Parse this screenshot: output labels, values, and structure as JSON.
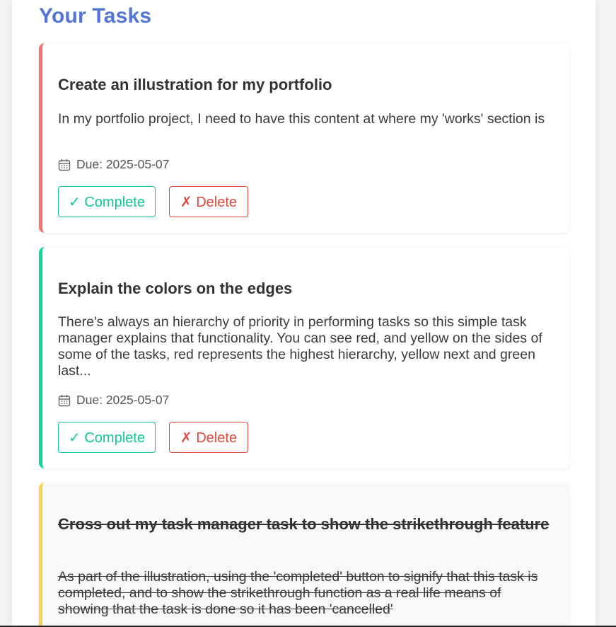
{
  "page": {
    "heading": "Your Tasks"
  },
  "colors": {
    "heading": "#5174d6",
    "priority_high": "#f87171",
    "priority_medium": "#fcd34d",
    "priority_low": "#10d6a0",
    "complete_button": "#10c799",
    "delete_button": "#e0483e"
  },
  "tasks": [
    {
      "title": "Create an illustration for my portfolio",
      "description": "In my portfolio project, I need to have this content at where my 'works' section is",
      "due": "Due: 2025-05-07",
      "priority": "high",
      "completed": false,
      "complete_label": "✓ Complete",
      "delete_label": "✗ Delete",
      "icon": "calendar-icon"
    },
    {
      "title": "Explain the colors on the edges",
      "description": "There's always an hierarchy of priority in performing tasks so this simple task manager explains that functionality. You can see red, and yellow on the sides of some of the tasks, red represents the highest hierarchy, yellow next and green last...",
      "due": "Due: 2025-05-07",
      "priority": "low",
      "completed": false,
      "complete_label": "✓ Complete",
      "delete_label": "✗ Delete",
      "icon": "calendar-icon"
    },
    {
      "title": "Cross out my task manager task to show the strikethrough feature",
      "description": "As part of the illustration, using the 'completed' button to signify that this task is completed, and to show the strikethrough function as a real life means of showing that the task is done so it has been 'cancelled'",
      "priority": "medium",
      "completed": true
    }
  ]
}
